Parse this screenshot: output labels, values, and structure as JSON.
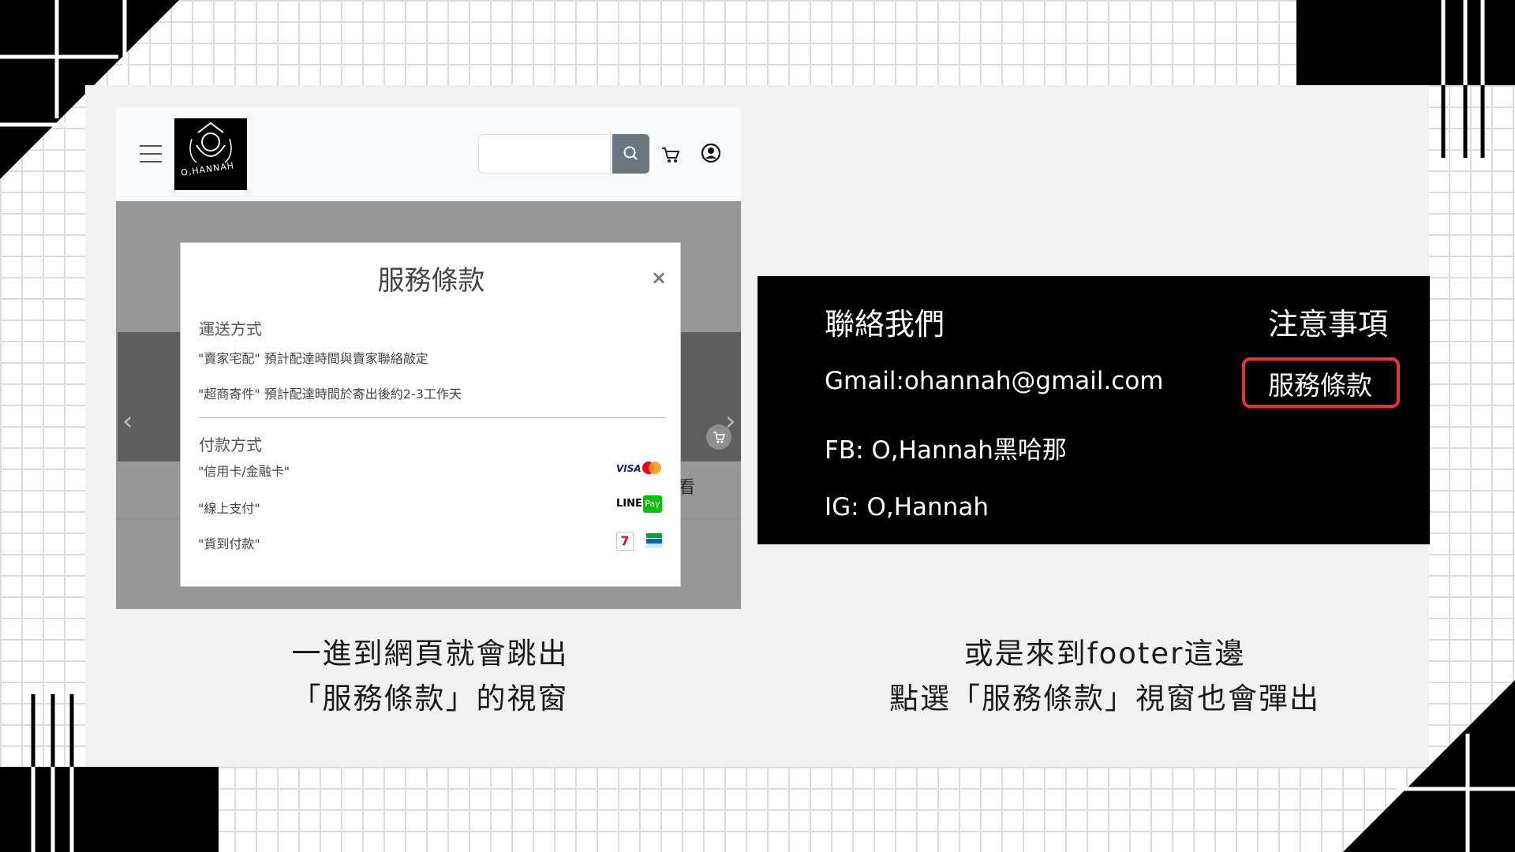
{
  "colors": {
    "accent_red": "#e8323a",
    "footer_bg": "#000000",
    "slide_bg": "#f1f1f1",
    "search_btn": "#6c757d"
  },
  "website": {
    "logo_text": "O,HANNAH",
    "icons": [
      "menu-icon",
      "search-icon",
      "cart-icon",
      "user-icon"
    ]
  },
  "modal": {
    "title": "服務條款",
    "close": "×",
    "shipping_heading": "運送方式",
    "shipping_items": [
      "\"賣家宅配\" 預計配達時間與賣家聯絡敲定",
      "\"超商寄件\" 預計配達時間於寄出後約2-3工作天"
    ],
    "payment_heading": "付款方式",
    "payment_items": [
      "\"信用卡/金融卡\"",
      "\"線上支付\"",
      "\"貨到付款\""
    ],
    "payment_logos": {
      "visa": "VISA",
      "line_1": "LINE",
      "line_2": "Pay",
      "seven": "7"
    }
  },
  "partial_text": "看",
  "footer": {
    "contact_heading": "聯絡我們",
    "notes_heading": "注意事項",
    "gmail": "Gmail:ohannah@gmail.com",
    "fb": "FB: O,Hannah黑哈那",
    "ig": "IG: O,Hannah",
    "tos_link": "服務條款"
  },
  "captions": {
    "left_1": "一進到網頁就會跳出",
    "left_2": "「服務條款」的視窗",
    "right_1": "或是來到footer這邊",
    "right_2": "點選「服務條款」視窗也會彈出"
  }
}
